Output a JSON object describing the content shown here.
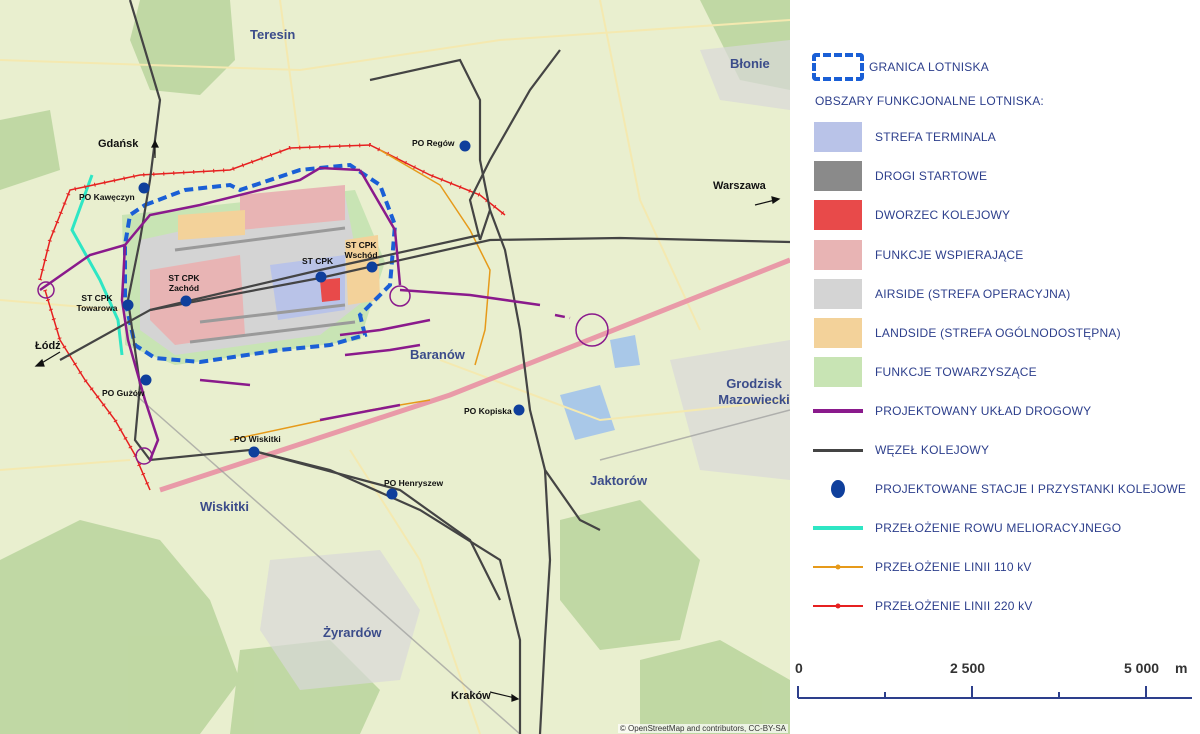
{
  "map": {
    "towns": [
      "Teresin",
      "Błonie",
      "Baranów",
      "Grodzisk Mazowiecki",
      "Jaktorów",
      "Wiskitki",
      "Żyrardów"
    ],
    "directions": [
      "Gdańsk",
      "Łódź",
      "Warszawa",
      "Kraków"
    ],
    "stations": {
      "po_regow": "PO Regów",
      "po_kaweczyn": "PO Kawęczyn",
      "st_cpk_towarowa": "ST CPK Towarowa",
      "st_cpk_zachod": "ST CPK Zachód",
      "st_cpk": "ST CPK",
      "st_cpk_wschod": "ST CPK Wschód",
      "po_guzow": "PO Guzów",
      "po_wiskitki": "PO Wiskitki",
      "po_henryszew": "PO Henryszew",
      "po_kopiska": "PO Kopiska"
    },
    "attribution": "© OpenStreetMap and contributors, CC-BY-SA"
  },
  "legend": {
    "airport_boundary": "GRANICA LOTNISKA",
    "functional_areas_heading": "OBSZARY FUNKCJONALNE LOTNISKA:",
    "terminal_zone": "STREFA TERMINALA",
    "runways": "DROGI STARTOWE",
    "railway_station": "DWORZEC KOLEJOWY",
    "supporting_functions": "FUNKCJE WSPIERAJĄCE",
    "airside": "AIRSIDE (STREFA OPERACYJNA)",
    "landside": "LANDSIDE (STREFA OGÓLNODOSTĘPNA)",
    "accompanying_functions": "FUNKCJE TOWARZYSZĄCE",
    "road_layout": "PROJEKTOWANY UKŁAD DROGOWY",
    "rail_node": "WĘZEŁ KOLEJOWY",
    "stations": "PROJEKTOWANE STACJE I PRZYSTANKI KOLEJOWE",
    "ditch_relocation": "PRZEŁOŻENIE ROWU MELIORACYJNEGO",
    "line_110kv": "PRZEŁOŻENIE LINII 110 kV",
    "line_220kv": "PRZEŁOŻENIE LINII 220 kV",
    "colors": {
      "boundary": "#1a5fd6",
      "terminal": "#b9c3e8",
      "runways": "#8a8a8a",
      "railway_station": "#e84a4a",
      "supporting": "#e8b4b4",
      "airside": "#d4d4d4",
      "landside": "#f3d29a",
      "accompanying": "#c8e4b4",
      "road": "#8a1a8c",
      "rail": "#444444",
      "station_dot": "#0f3f9c",
      "ditch": "#2ee6c4",
      "line_110": "#e69a1a",
      "line_220": "#e62020"
    }
  },
  "scale": {
    "labels": [
      "0",
      "2 500",
      "5 000",
      "m"
    ]
  }
}
